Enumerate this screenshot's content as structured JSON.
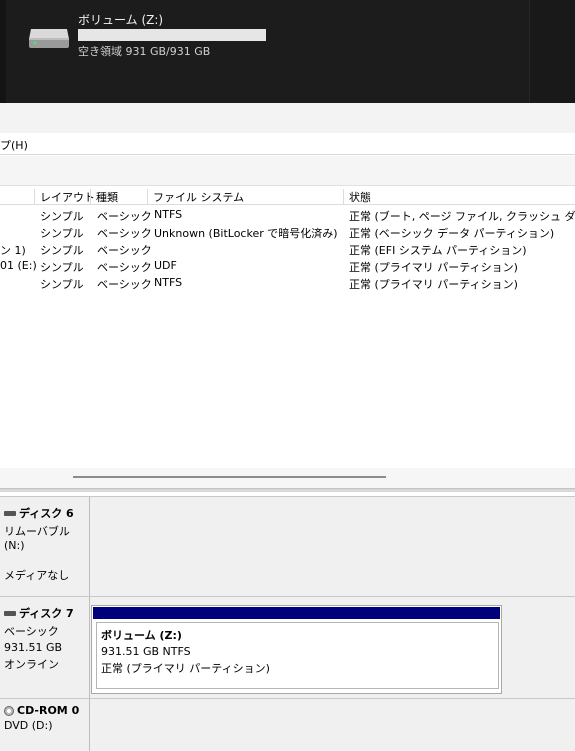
{
  "explorer": {
    "drive_name": "ボリューム (Z:)",
    "drive_free": "空き領域 931 GB/931 GB",
    "drive_icon": "hard-drive-icon"
  },
  "menu": {
    "help": "プ(H)"
  },
  "volume_table": {
    "headers": [
      "レイアウト",
      "種類",
      "ファイル システム",
      "状態"
    ],
    "rows": [
      {
        "name": "",
        "layout": "シンプル",
        "type": "ベーシック",
        "fs": "NTFS",
        "status": "正常 (ブート, ページ ファイル, クラッシュ ダンプ, ベー"
      },
      {
        "name": "",
        "layout": "シンプル",
        "type": "ベーシック",
        "fs": "Unknown (BitLocker で暗号化済み)",
        "status": "正常 (ベーシック データ パーティション)"
      },
      {
        "name": "ン 1)",
        "layout": "シンプル",
        "type": "ベーシック",
        "fs": "",
        "status": "正常 (EFI システム パーティション)"
      },
      {
        "name": "01 (E:)",
        "layout": "シンプル",
        "type": "ベーシック",
        "fs": "UDF",
        "status": "正常 (プライマリ パーティション)"
      },
      {
        "name": "",
        "layout": "シンプル",
        "type": "ベーシック",
        "fs": "NTFS",
        "status": "正常 (プライマリ パーティション)"
      }
    ]
  },
  "disks": {
    "disk6": {
      "title": "ディスク 6",
      "line1": "リムーバブル (N:)",
      "line2": "メディアなし"
    },
    "disk7": {
      "title": "ディスク 7",
      "line1": "ベーシック",
      "line2": "931.51 GB",
      "line3": "オンライン"
    },
    "cdrom0": {
      "title": "CD-ROM 0",
      "line1": "DVD (D:)"
    }
  },
  "partition": {
    "name": "ボリューム  (Z:)",
    "size": "931.51 GB NTFS",
    "status": "正常 (プライマリ パーティション)",
    "band_color": "#00007a"
  }
}
